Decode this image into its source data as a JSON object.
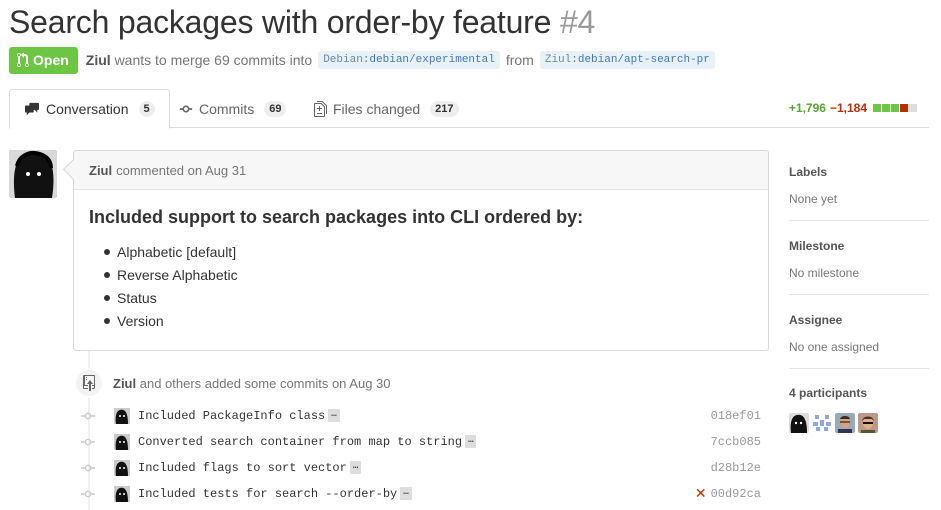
{
  "pr": {
    "title": "Search packages with order-by feature",
    "number": "#4",
    "state": "Open",
    "author": "Ziul",
    "merge_text": "wants to merge 69 commits into",
    "base_user": "Debian",
    "base_branch": ":debian/experimental",
    "from_text": "from",
    "head_user": "Ziul",
    "head_branch": ":debian/apt-search-pr"
  },
  "tabs": [
    {
      "label": "Conversation",
      "count": "5",
      "icon": "comment-discussion-icon"
    },
    {
      "label": "Commits",
      "count": "69",
      "icon": "git-commit-icon"
    },
    {
      "label": "Files changed",
      "count": "217",
      "icon": "diff-icon"
    }
  ],
  "diffstat": {
    "additions": "+1,796",
    "deletions": "−1,184",
    "colors": {
      "add": "#6cc644",
      "del": "#bd2c00",
      "neutral": "#ddd"
    }
  },
  "comment": {
    "author": "Ziul",
    "meta": "commented on Aug 31",
    "heading": "Included support to search packages into CLI ordered by:",
    "items": [
      "Alphabetic [default]",
      "Reverse Alphabetic",
      "Status",
      "Version"
    ]
  },
  "push": {
    "author": "Ziul",
    "text": "and others added some commits on Aug 30",
    "commits": [
      {
        "message": "Included PackageInfo class",
        "sha": "018ef01",
        "status": ""
      },
      {
        "message": "Converted search container from map to string",
        "sha": "7ccb085",
        "status": ""
      },
      {
        "message": "Included flags to sort vector",
        "sha": "d28b12e",
        "status": ""
      },
      {
        "message": "Included tests for search --order-by",
        "sha": "00d92ca",
        "status": "failed"
      }
    ],
    "ellipsis": "…"
  },
  "sidebar": {
    "labels": {
      "title": "Labels",
      "value": "None yet"
    },
    "milestone": {
      "title": "Milestone",
      "value": "No milestone"
    },
    "assignee": {
      "title": "Assignee",
      "value": "No one assigned"
    },
    "participants": {
      "title": "4 participants"
    }
  },
  "colors": {
    "open_green": "#6cc644",
    "link_blue": "#4078c0",
    "fail_red": "#bd2c00"
  }
}
